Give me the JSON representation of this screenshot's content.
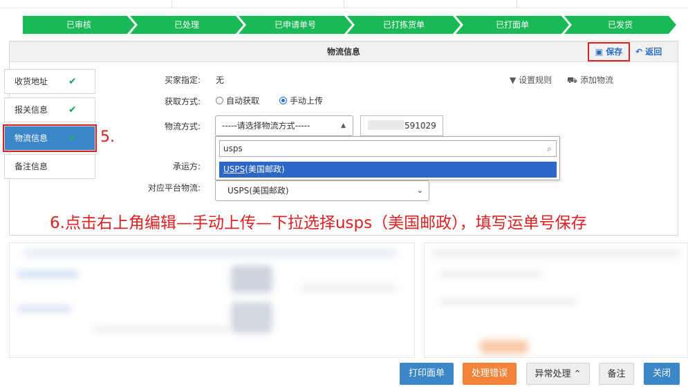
{
  "steps": [
    "已审核",
    "已处理",
    "已申请单号",
    "已打拣货单",
    "已打面单",
    "已发货"
  ],
  "panel": {
    "title": "物流信息",
    "save_label": "保存",
    "back_label": "返回"
  },
  "side_tabs": [
    {
      "label": "收货地址",
      "checked": true
    },
    {
      "label": "报关信息",
      "checked": true
    },
    {
      "label": "物流信息",
      "checked": true,
      "active": true
    },
    {
      "label": "备注信息",
      "checked": false
    }
  ],
  "check_mark": "✔",
  "step5_label": "5.",
  "form": {
    "buyer_label": "买家指定:",
    "buyer_value": "无",
    "method_label": "获取方式:",
    "method_options": [
      "自动获取",
      "手动上传"
    ],
    "method_selected": "手动上传",
    "logistics_label": "物流方式:",
    "logistics_placeholder": "-----请选择物流方式-----",
    "tracking_visible": "591029",
    "carrier_label": "承运方:",
    "platform_label": "对应平台物流:",
    "platform_value": "USPS(美国邮政)",
    "set_rule": "设置规则",
    "add_logistics": "添加物流"
  },
  "dropdown": {
    "search_text": "usps",
    "option_prefix": "USPS",
    "option_suffix": "(美国邮政)"
  },
  "instruction": "6.点击右上角编辑—手动上传—下拉选择usps（美国邮政），填写运单号保存",
  "bottom_buttons": {
    "print_label": "打印面单",
    "error_label": "处理错误",
    "exception_label": "异常处理",
    "note_label": "备注",
    "close_label": "关闭"
  },
  "colors": {
    "step_green": "#19b955",
    "accent_blue": "#3a86c8",
    "highlight_red": "#e02020",
    "orange": "#f5843a"
  }
}
